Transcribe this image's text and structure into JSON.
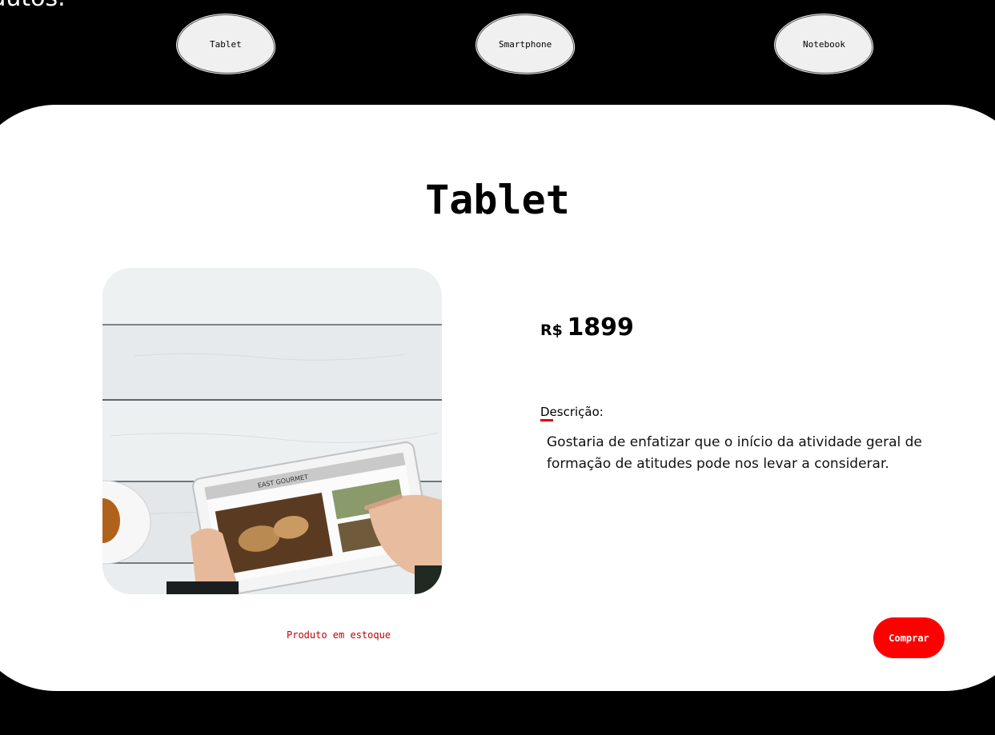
{
  "page": {
    "heading_fragment": "odutos."
  },
  "nav": {
    "items": [
      {
        "label": "Tablet"
      },
      {
        "label": "Smartphone"
      },
      {
        "label": "Notebook"
      }
    ]
  },
  "product": {
    "title": "Tablet",
    "price": {
      "currency": "R$",
      "amount": "1899"
    },
    "description_label": "Descrição:",
    "description": "Gostaria de enfatizar que o início da atividade geral de formação de atitudes pode nos levar a considerar.",
    "stock_status": "Produto em estoque",
    "buy_label": "Comprar",
    "photo": {
      "screen_title": "EAST GOURMET",
      "icon": "tablet-on-wooden-table-photo"
    }
  },
  "colors": {
    "background": "#000000",
    "card": "#ffffff",
    "accent": "#ff0000",
    "stock_text": "#c00000",
    "nav_pill": "#f0f0f0"
  }
}
